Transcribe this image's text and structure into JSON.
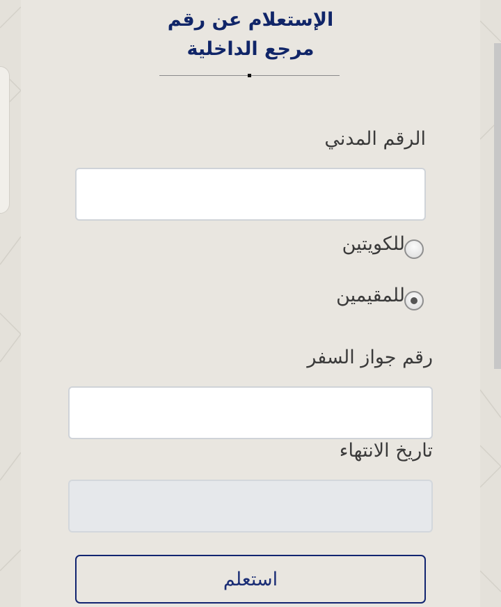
{
  "page": {
    "title": "الإستعلام عن رقم مرجع الداخلية"
  },
  "form": {
    "civil_id": {
      "label": "الرقم المدني",
      "value": "",
      "placeholder": ""
    },
    "residency": {
      "options": [
        {
          "label": "للكويتين",
          "selected": false
        },
        {
          "label": "للمقيمين",
          "selected": true
        }
      ]
    },
    "passport": {
      "label": "رقم جواز السفر",
      "value": "",
      "placeholder": ""
    },
    "expiry": {
      "label": "تاريخ الانتهاء",
      "value": "",
      "placeholder": "",
      "disabled": true
    },
    "submit_label": "استعلم"
  },
  "colors": {
    "accent": "#102568",
    "panel": "#e9e6e0",
    "background": "#e4e1da"
  }
}
